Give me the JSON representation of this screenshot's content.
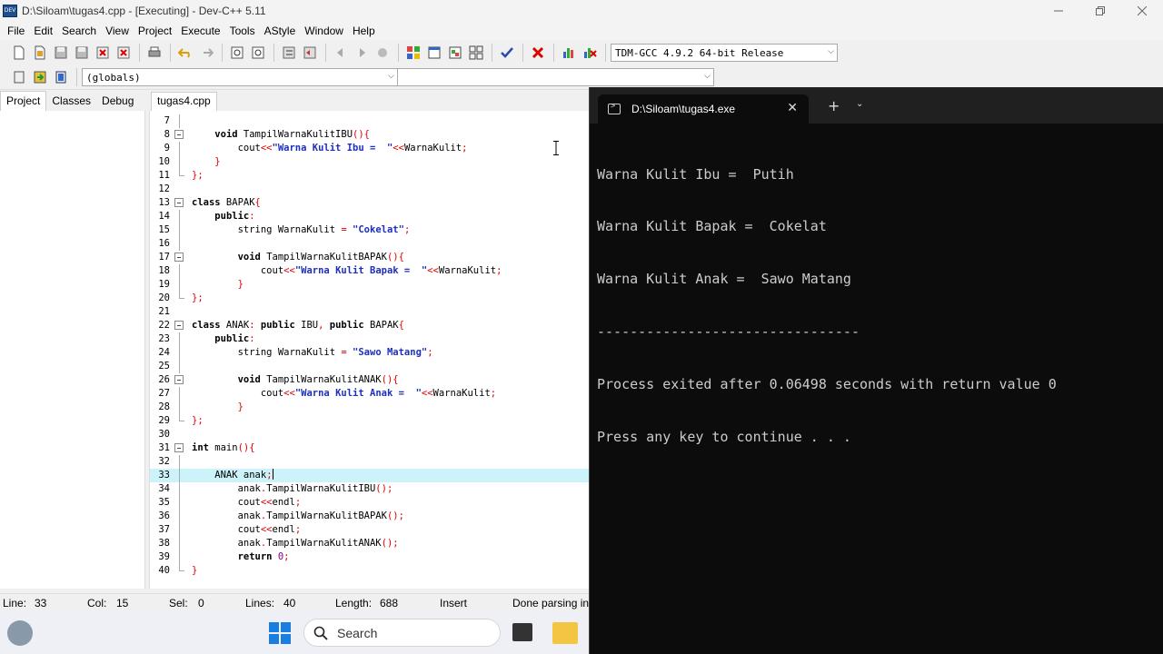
{
  "window": {
    "title": "D:\\Siloam\\tugas4.cpp - [Executing] - Dev-C++ 5.11",
    "app_icon_label": "DEV"
  },
  "menu": [
    "File",
    "Edit",
    "Search",
    "View",
    "Project",
    "Execute",
    "Tools",
    "AStyle",
    "Window",
    "Help"
  ],
  "toolbar": {
    "compiler": "TDM-GCC 4.9.2 64-bit Release",
    "scope": "(globals)",
    "function": ""
  },
  "panel": {
    "tabs": [
      "Project",
      "Classes",
      "Debug"
    ]
  },
  "editor": {
    "file_tab": "tugas4.cpp",
    "lines": [
      {
        "n": "7",
        "code": ""
      },
      {
        "n": "8",
        "code": "    void TampilWarnaKulitIBU(){"
      },
      {
        "n": "9",
        "code": "        cout<<\"Warna Kulit Ibu =  \"<<WarnaKulit;"
      },
      {
        "n": "10",
        "code": "    }"
      },
      {
        "n": "11",
        "code": "};"
      },
      {
        "n": "12",
        "code": ""
      },
      {
        "n": "13",
        "code": "class BAPAK{"
      },
      {
        "n": "14",
        "code": "    public:"
      },
      {
        "n": "15",
        "code": "        string WarnaKulit = \"Cokelat\";"
      },
      {
        "n": "16",
        "code": ""
      },
      {
        "n": "17",
        "code": "        void TampilWarnaKulitBAPAK(){"
      },
      {
        "n": "18",
        "code": "            cout<<\"Warna Kulit Bapak =  \"<<WarnaKulit;"
      },
      {
        "n": "19",
        "code": "        }"
      },
      {
        "n": "20",
        "code": "};"
      },
      {
        "n": "21",
        "code": ""
      },
      {
        "n": "22",
        "code": "class ANAK: public IBU, public BAPAK{"
      },
      {
        "n": "23",
        "code": "    public:"
      },
      {
        "n": "24",
        "code": "        string WarnaKulit = \"Sawo Matang\";"
      },
      {
        "n": "25",
        "code": ""
      },
      {
        "n": "26",
        "code": "        void TampilWarnaKulitANAK(){"
      },
      {
        "n": "27",
        "code": "            cout<<\"Warna Kulit Anak =  \"<<WarnaKulit;"
      },
      {
        "n": "28",
        "code": "        }"
      },
      {
        "n": "29",
        "code": "};"
      },
      {
        "n": "30",
        "code": ""
      },
      {
        "n": "31",
        "code": "int main(){"
      },
      {
        "n": "32",
        "code": ""
      },
      {
        "n": "33",
        "code": "    ANAK anak;"
      },
      {
        "n": "34",
        "code": "        anak.TampilWarnaKulitIBU();"
      },
      {
        "n": "35",
        "code": "        cout<<endl;"
      },
      {
        "n": "36",
        "code": "        anak.TampilWarnaKulitBAPAK();"
      },
      {
        "n": "37",
        "code": "        cout<<endl;"
      },
      {
        "n": "38",
        "code": "        anak.TampilWarnaKulitANAK();"
      },
      {
        "n": "39",
        "code": "        return 0;"
      },
      {
        "n": "40",
        "code": "}"
      }
    ]
  },
  "status": {
    "line_label": "Line:",
    "line": "33",
    "col_label": "Col:",
    "col": "15",
    "sel_label": "Sel:",
    "sel": "0",
    "lines_label": "Lines:",
    "lines": "40",
    "length_label": "Length:",
    "length": "688",
    "mode": "Insert",
    "message": "Done parsing in"
  },
  "taskbar": {
    "search_placeholder": "Search"
  },
  "terminal": {
    "tab_title": "D:\\Siloam\\tugas4.exe",
    "output": [
      "Warna Kulit Ibu =  Putih",
      "Warna Kulit Bapak =  Cokelat",
      "Warna Kulit Anak =  Sawo Matang",
      "--------------------------------",
      "Process exited after 0.06498 seconds with return value 0",
      "Press any key to continue . . ."
    ]
  }
}
